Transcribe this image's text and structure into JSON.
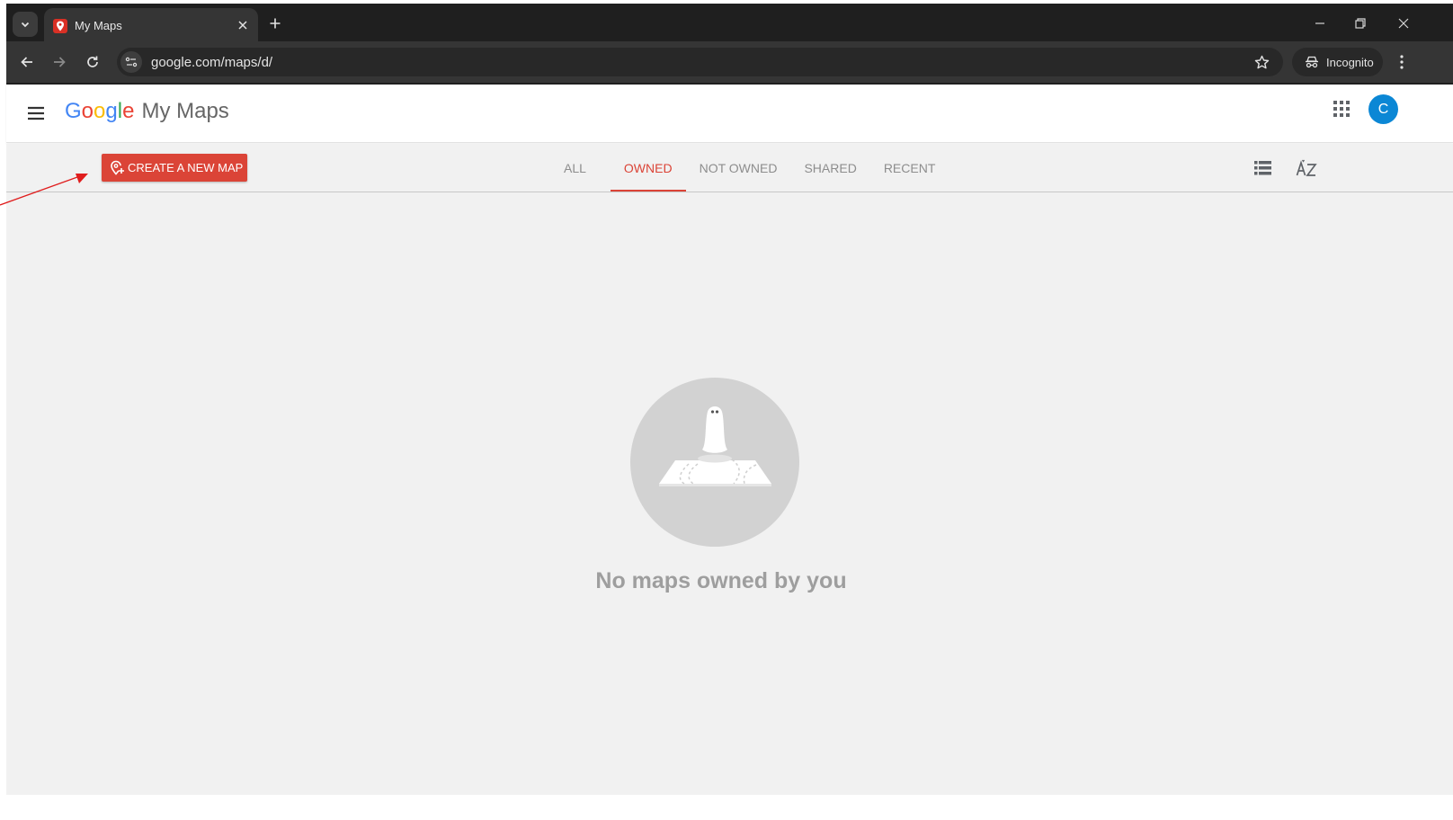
{
  "browser": {
    "tab_title": "My Maps",
    "url": "google.com/maps/d/",
    "incognito_label": "Incognito"
  },
  "header": {
    "logo_letters": [
      "G",
      "o",
      "o",
      "g",
      "l",
      "e"
    ],
    "product_name": "My Maps",
    "avatar_initial": "C",
    "avatar_color": "#0b87d5"
  },
  "filter_bar": {
    "create_label": "CREATE A NEW MAP",
    "tabs": [
      {
        "label": "ALL",
        "active": false
      },
      {
        "label": "OWNED",
        "active": true
      },
      {
        "label": "NOT OWNED",
        "active": false
      },
      {
        "label": "SHARED",
        "active": false
      },
      {
        "label": "RECENT",
        "active": false
      }
    ],
    "accent_color": "#db4437"
  },
  "main": {
    "empty_message": "No maps owned by you"
  },
  "icons": {
    "tab_search": "chevron-down-icon",
    "favicon": "map-pin-icon",
    "close": "close-icon",
    "new_tab": "plus-icon",
    "back": "arrow-left-icon",
    "forward": "arrow-right-icon",
    "reload": "reload-icon",
    "bookmark": "star-icon",
    "apps": "grid-icon",
    "list_view": "list-icon",
    "sort": "sort-az-icon"
  }
}
